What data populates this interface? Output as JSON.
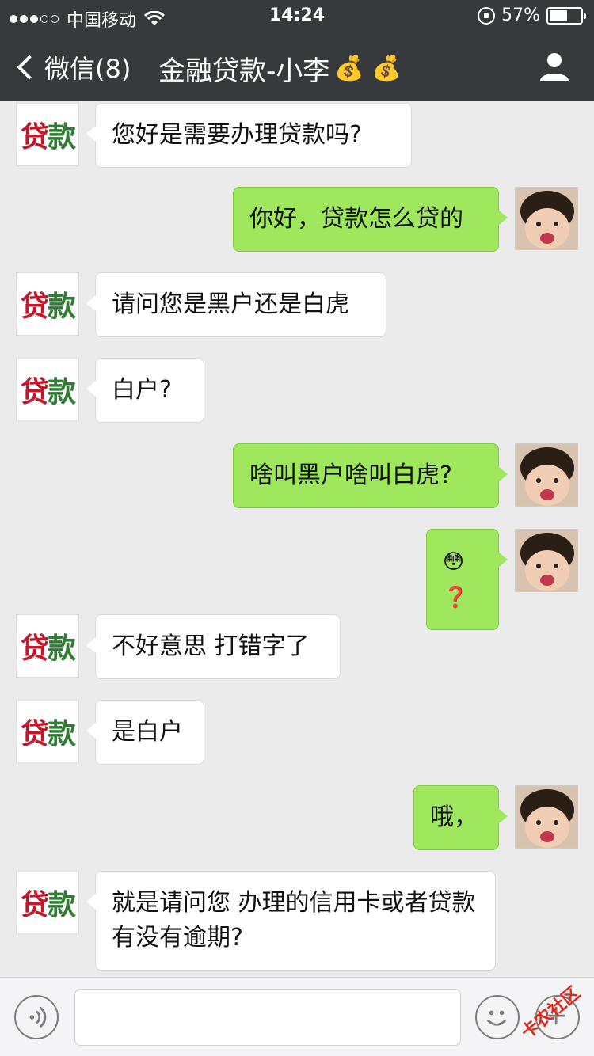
{
  "status_bar": {
    "carrier": "中国移动",
    "time": "14:24",
    "battery": "57%",
    "battery_level": 0.57
  },
  "nav": {
    "back_label": "微信(8)",
    "title": "金融贷款-小李",
    "title_emoji": "💰 💰"
  },
  "avatar_text": {
    "char1": "贷",
    "char2": "款"
  },
  "messages": [
    {
      "side": "left",
      "text": "您好是需要办理贷款吗?"
    },
    {
      "side": "right",
      "text": "你好，贷款怎么贷的"
    },
    {
      "side": "left",
      "text": "请问您是黑户还是白虎"
    },
    {
      "side": "left",
      "text": "白户?"
    },
    {
      "side": "right",
      "text": "啥叫黑户啥叫白虎?"
    },
    {
      "side": "right",
      "text": "😳❓",
      "emoji": true
    },
    {
      "side": "left",
      "text": "不好意思 打错字了"
    },
    {
      "side": "left",
      "text": "是白户"
    },
    {
      "side": "right",
      "text": "哦，"
    },
    {
      "side": "left",
      "text": "就是请问您 办理的信用卡或者贷款有没有逾期?"
    }
  ],
  "watermark": "卡农社区"
}
